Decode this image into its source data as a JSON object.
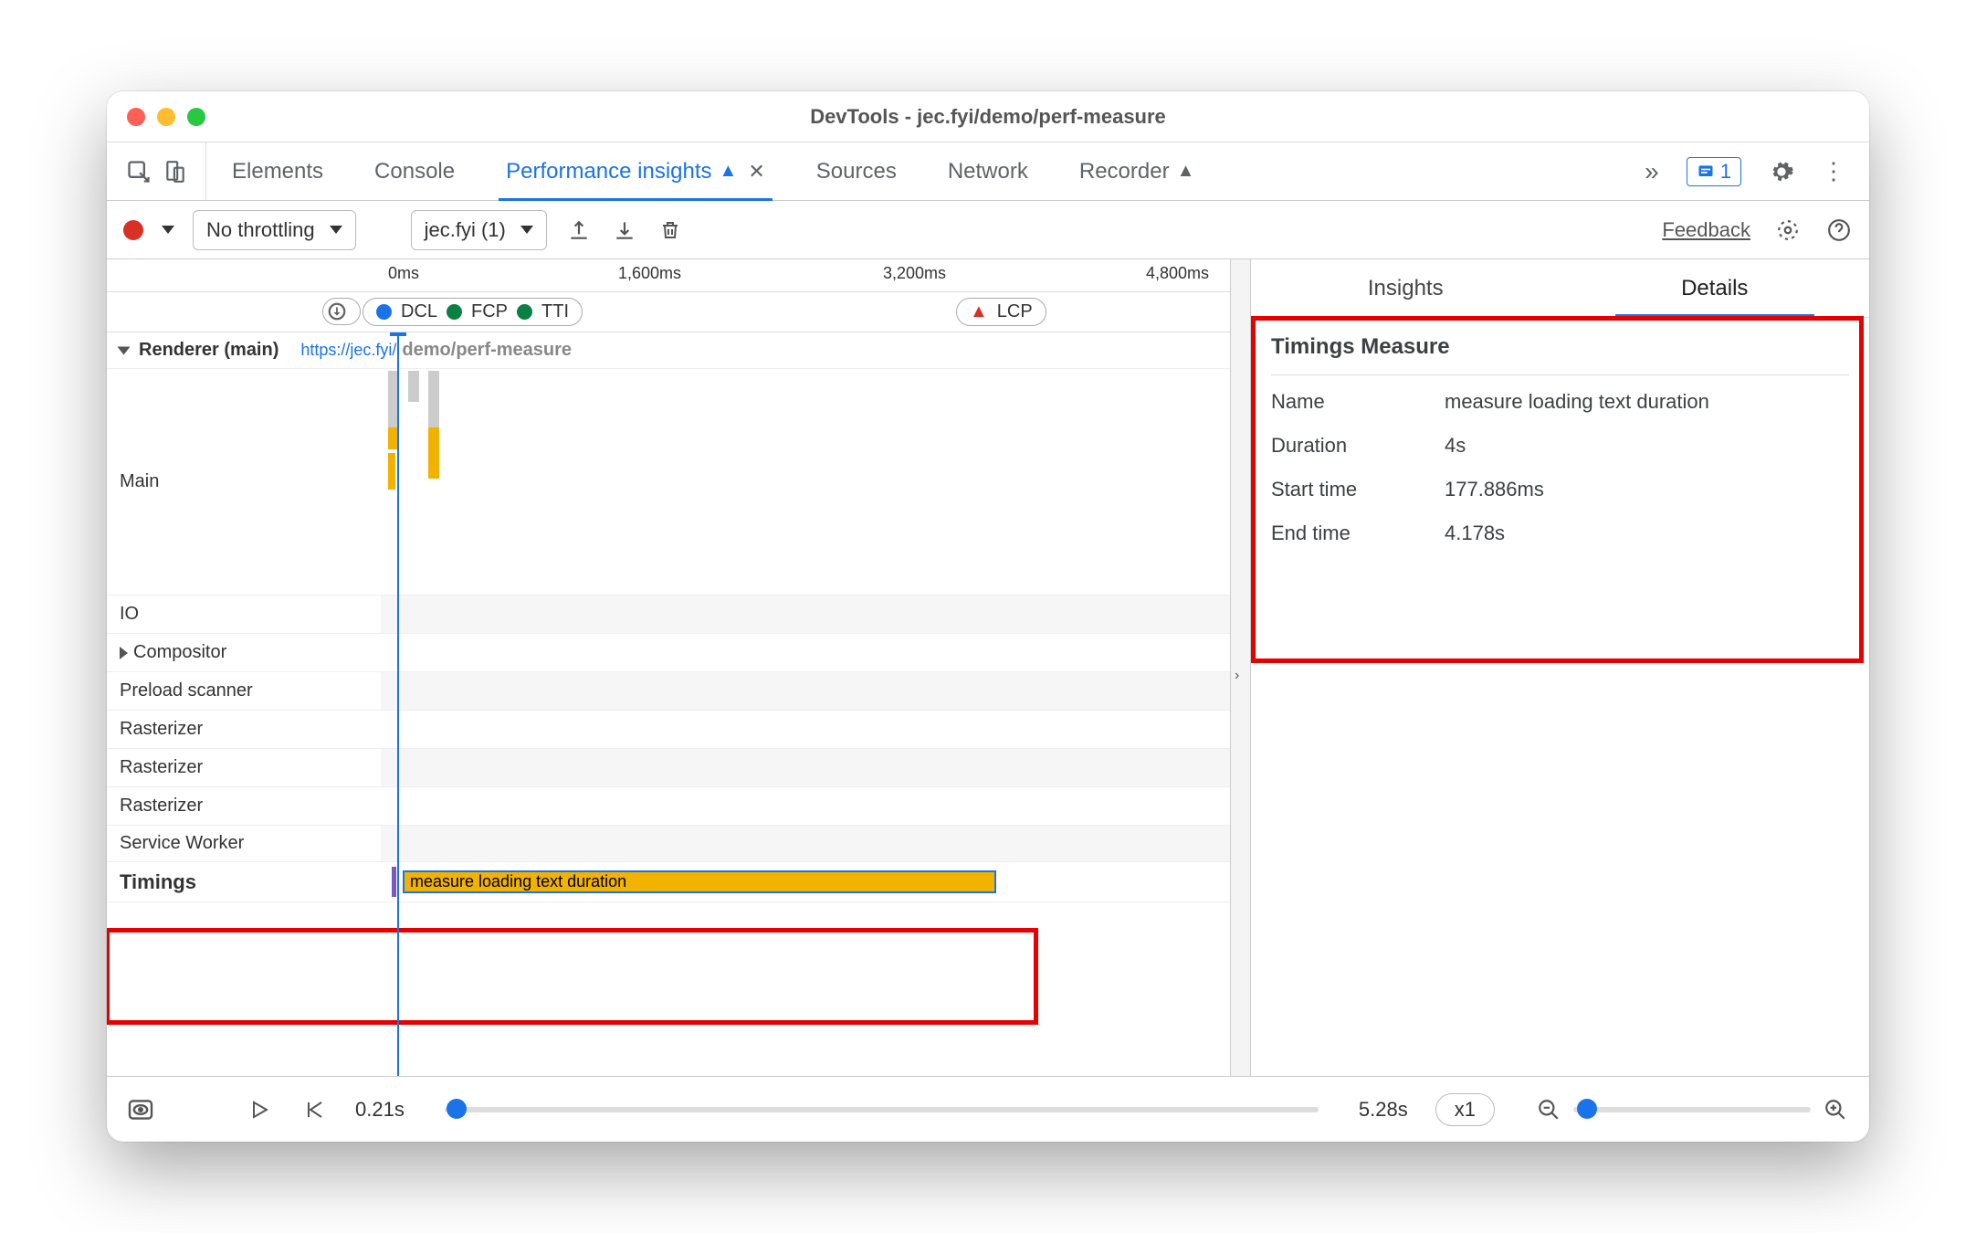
{
  "window_title": "DevTools - jec.fyi/demo/perf-measure",
  "tabs": {
    "elements": "Elements",
    "console": "Console",
    "perf_insights": "Performance insights",
    "sources": "Sources",
    "network": "Network",
    "recorder": "Recorder"
  },
  "issues_count": "1",
  "toolbar": {
    "throttling": "No throttling",
    "recording": "jec.fyi (1)",
    "feedback": "Feedback"
  },
  "ruler": {
    "t0": "0ms",
    "t1": "1,600ms",
    "t2": "3,200ms",
    "t3": "4,800ms"
  },
  "markers": {
    "dcl": "DCL",
    "fcp": "FCP",
    "tti": "TTI",
    "lcp": "LCP"
  },
  "tracks": {
    "renderer": "Renderer (main)",
    "renderer_url1": "https://jec.fyi/",
    "renderer_url2": "demo/perf-measure",
    "main": "Main",
    "io": "IO",
    "compositor": "Compositor",
    "preload": "Preload scanner",
    "raster": "Rasterizer",
    "service": "Service Worker",
    "timings": "Timings"
  },
  "measure_label": "measure loading text duration",
  "side_tabs": {
    "insights": "Insights",
    "details": "Details"
  },
  "details": {
    "title": "Timings Measure",
    "name_k": "Name",
    "name_v": "measure loading text duration",
    "dur_k": "Duration",
    "dur_v": "4s",
    "start_k": "Start time",
    "start_v": "177.886ms",
    "end_k": "End time",
    "end_v": "4.178s"
  },
  "footer": {
    "start": "0.21s",
    "end": "5.28s",
    "speed": "x1"
  }
}
